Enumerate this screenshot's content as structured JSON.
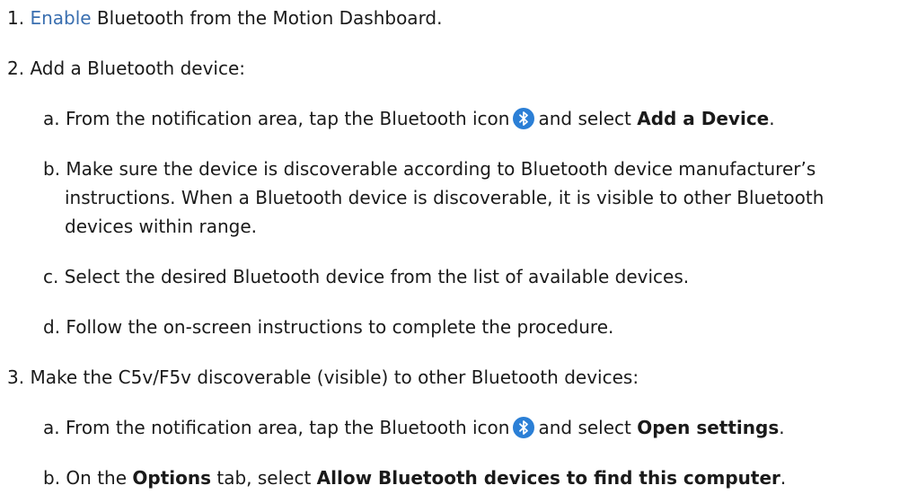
{
  "step1": {
    "number": "1.",
    "link": "Enable",
    "text": " Bluetooth from the Motion Dashboard."
  },
  "step2": {
    "number": "2.",
    "text": "Add a Bluetooth device:",
    "a": {
      "letter": "a.",
      "pre": "From the notification area, tap the Bluetooth icon",
      "mid": "and select ",
      "bold": "Add a Device",
      "end": "."
    },
    "b": {
      "letter": "b.",
      "line1": "Make sure the device is discoverable according to Bluetooth device manufacturer’s",
      "line2": "instructions. When a Bluetooth device is discoverable, it is visible to other Bluetooth",
      "line3": "devices within range."
    },
    "c": {
      "letter": "c.",
      "text": "Select the desired Bluetooth device from the list of available devices."
    },
    "d": {
      "letter": "d.",
      "text": "Follow the on-screen instructions to complete the procedure."
    }
  },
  "step3": {
    "number": "3.",
    "text": "Make the C5v/F5v discoverable (visible) to other Bluetooth devices:",
    "a": {
      "letter": "a.",
      "pre": "From the notification area, tap the Bluetooth icon",
      "mid": "and select ",
      "bold": "Open settings",
      "end": "."
    },
    "b": {
      "letter": "b.",
      "pre": "On the ",
      "bold1": "Options",
      "mid": " tab, select ",
      "bold2": "Allow Bluetooth devices to find this computer",
      "end": "."
    }
  },
  "icons": {
    "bluetooth": "bluetooth-icon",
    "bluetooth_color": "#2b7fd6"
  },
  "colors": {
    "link": "#3a6fb0",
    "text": "#1a1a1a"
  }
}
